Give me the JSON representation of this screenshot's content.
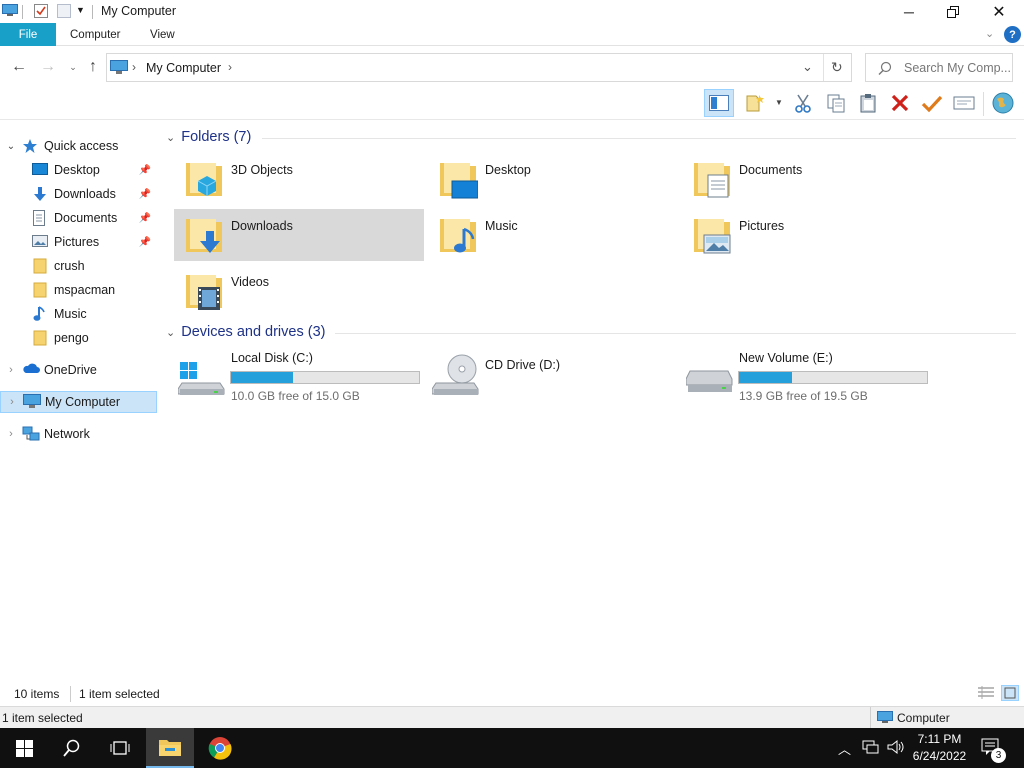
{
  "window": {
    "title": "My Computer"
  },
  "ribbon": {
    "tabs": [
      "File",
      "Computer",
      "View"
    ]
  },
  "address": {
    "path": "My Computer",
    "search_placeholder": "Search My Comp..."
  },
  "nav": {
    "quick_access": "Quick access",
    "items": [
      {
        "label": "Desktop",
        "pinned": true
      },
      {
        "label": "Downloads",
        "pinned": true
      },
      {
        "label": "Documents",
        "pinned": true
      },
      {
        "label": "Pictures",
        "pinned": true
      },
      {
        "label": "crush"
      },
      {
        "label": "mspacman"
      },
      {
        "label": "Music"
      },
      {
        "label": "pengo"
      }
    ],
    "onedrive": "OneDrive",
    "my_computer": "My Computer",
    "network": "Network"
  },
  "content": {
    "folders_header": "Folders (7)",
    "folders": [
      "3D Objects",
      "Desktop",
      "Documents",
      "Downloads",
      "Music",
      "Pictures",
      "Videos"
    ],
    "drives_header": "Devices and drives (3)",
    "drives": [
      {
        "name": "Local Disk (C:)",
        "free": "10.0 GB free of 15.0 GB",
        "used_fraction": 0.33
      },
      {
        "name": "CD Drive (D:)"
      },
      {
        "name": "New Volume (E:)",
        "free": "13.9 GB free of 19.5 GB",
        "used_fraction": 0.28
      }
    ]
  },
  "status": {
    "items": "10 items",
    "selected": "1 item selected",
    "bottom_left": "1 item selected",
    "bottom_right": "Computer"
  },
  "taskbar": {
    "time": "7:11 PM",
    "date": "6/24/2022",
    "notifications": "3"
  },
  "colors": {
    "accent": "#19a0c8",
    "folder": "#f4cf6b",
    "drive_fill": "#26a0da",
    "header_text": "#1e3287"
  }
}
